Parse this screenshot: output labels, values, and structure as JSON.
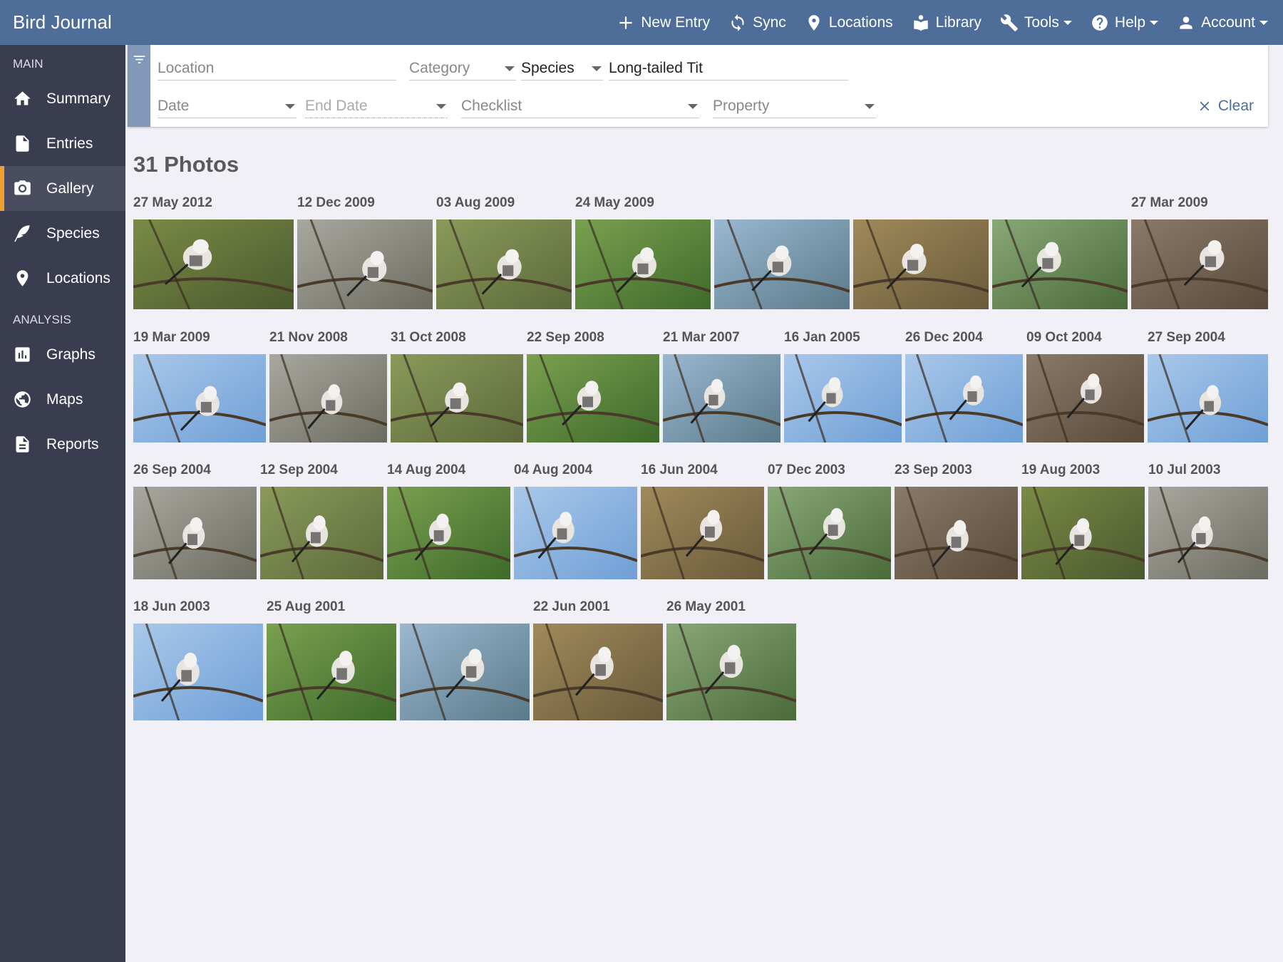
{
  "app": {
    "title": "Bird Journal"
  },
  "topnav": [
    {
      "label": "New Entry",
      "icon": "plus-icon"
    },
    {
      "label": "Sync",
      "icon": "sync-icon"
    },
    {
      "label": "Locations",
      "icon": "map-pin-icon"
    },
    {
      "label": "Library",
      "icon": "library-icon"
    },
    {
      "label": "Tools",
      "icon": "wrench-icon",
      "dropdown": true
    },
    {
      "label": "Help",
      "icon": "help-icon",
      "dropdown": true
    },
    {
      "label": "Account",
      "icon": "user-icon",
      "dropdown": true
    }
  ],
  "sidebar": {
    "main_heading": "MAIN",
    "analysis_heading": "ANALYSIS",
    "items": [
      {
        "label": "Summary",
        "icon": "home-icon"
      },
      {
        "label": "Entries",
        "icon": "document-icon"
      },
      {
        "label": "Gallery",
        "icon": "camera-icon",
        "active": true
      },
      {
        "label": "Species",
        "icon": "feather-icon"
      },
      {
        "label": "Locations",
        "icon": "map-pin-icon"
      },
      {
        "label": "Graphs",
        "icon": "bar-chart-icon"
      },
      {
        "label": "Maps",
        "icon": "globe-icon"
      },
      {
        "label": "Reports",
        "icon": "report-icon"
      }
    ]
  },
  "filter": {
    "location_placeholder": "Location",
    "category_placeholder": "Category",
    "species_label": "Species",
    "species_value": "Long-tailed Tit",
    "date_placeholder": "Date",
    "end_date_placeholder": "End Date",
    "checklist_placeholder": "Checklist",
    "property_placeholder": "Property",
    "clear_label": "Clear"
  },
  "gallery": {
    "count_label": "31 Photos",
    "rows": [
      [
        "27 May 2012",
        "12 Dec 2009",
        "03 Aug 2009",
        "24 May 2009",
        "",
        "",
        "",
        "27 Mar 2009"
      ],
      [
        "19 Mar 2009",
        "21 Nov 2008",
        "31 Oct 2008",
        "22 Sep 2008",
        "21 Mar 2007",
        "16 Jan 2005",
        "26 Dec 2004",
        "09 Oct 2004",
        "27 Sep 2004"
      ],
      [
        "26 Sep 2004",
        "12 Sep 2004",
        "14 Aug 2004",
        "04 Aug 2004",
        "16 Jun 2004",
        "07 Dec 2003",
        "23 Sep 2003",
        "19 Aug 2003",
        "10 Jul 2003"
      ],
      [
        "18 Jun 2003",
        "25 Aug 2001",
        "",
        "22 Jun 2001",
        "26 May 2001"
      ]
    ]
  }
}
